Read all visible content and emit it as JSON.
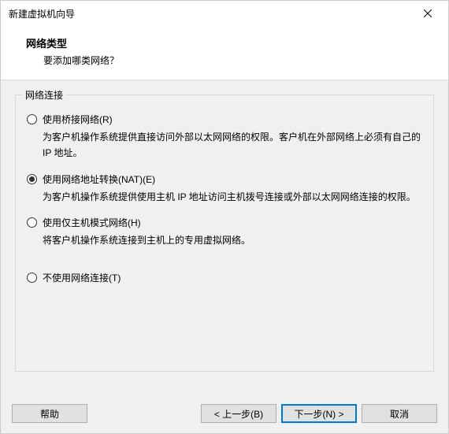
{
  "window": {
    "title": "新建虚拟机向导"
  },
  "header": {
    "title": "网络类型",
    "subtitle": "要添加哪类网络？"
  },
  "group": {
    "legend": "网络连接",
    "options": [
      {
        "label": "使用桥接网络(R)",
        "desc": "为客户机操作系统提供直接访问外部以太网网络的权限。客户机在外部网络上必须有自己的 IP 地址。",
        "checked": false
      },
      {
        "label": "使用网络地址转换(NAT)(E)",
        "desc": "为客户机操作系统提供使用主机 IP 地址访问主机拨号连接或外部以太网网络连接的权限。",
        "checked": true
      },
      {
        "label": "使用仅主机模式网络(H)",
        "desc": "将客户机操作系统连接到主机上的专用虚拟网络。",
        "checked": false
      },
      {
        "label": "不使用网络连接(T)",
        "desc": "",
        "checked": false
      }
    ]
  },
  "buttons": {
    "help": "帮助",
    "back": "< 上一步(B)",
    "next": "下一步(N) >",
    "cancel": "取消"
  }
}
